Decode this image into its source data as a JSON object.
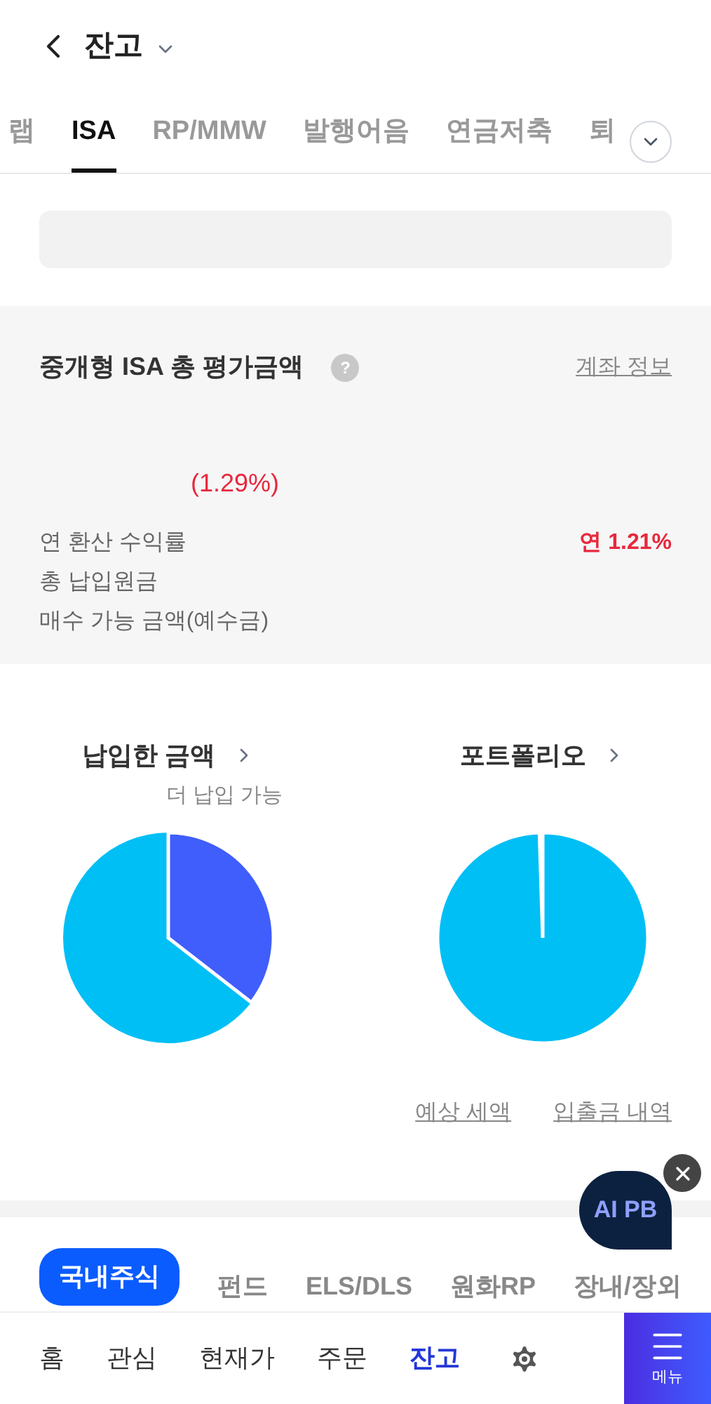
{
  "header": {
    "title": "잔고"
  },
  "account_tabs": [
    {
      "label": "랩",
      "selected": false
    },
    {
      "label": "ISA",
      "selected": true
    },
    {
      "label": "RP/MMW",
      "selected": false
    },
    {
      "label": "발행어음",
      "selected": false
    },
    {
      "label": "연금저축",
      "selected": false
    },
    {
      "label": "퇴",
      "selected": false
    }
  ],
  "summary": {
    "title": "중개형 ISA 총 평가금액",
    "help": "?",
    "account_link": "계좌 정보",
    "return_rate": "(1.29%)",
    "rows": [
      {
        "label": "연 환산 수익률",
        "value": "연 1.21%"
      },
      {
        "label": "총 납입원금"
      },
      {
        "label": "매수 가능 금액(예수금)"
      }
    ]
  },
  "charts": [
    {
      "title": "납입한 금액",
      "note": "더 납입 가능"
    },
    {
      "title": "포트폴리오"
    }
  ],
  "links": [
    "예상 세액",
    "입출금 내역"
  ],
  "ai_badge": "AI PB",
  "asset_tabs": [
    {
      "label": "국내주식",
      "selected": true
    },
    {
      "label": "펀드",
      "selected": false
    },
    {
      "label": "ELS/DLS",
      "selected": false
    },
    {
      "label": "원화RP",
      "selected": false
    },
    {
      "label": "장내/장외",
      "selected": false
    }
  ],
  "nav": [
    {
      "kind": "text",
      "label": "홈",
      "selected": false
    },
    {
      "kind": "text",
      "label": "관심",
      "selected": false
    },
    {
      "kind": "text",
      "label": "현재가",
      "selected": false
    },
    {
      "kind": "text",
      "label": "주문",
      "selected": false
    },
    {
      "kind": "text",
      "label": "잔고",
      "selected": true
    },
    {
      "kind": "settings",
      "selected": false
    }
  ],
  "menu_button": "메뉴"
}
